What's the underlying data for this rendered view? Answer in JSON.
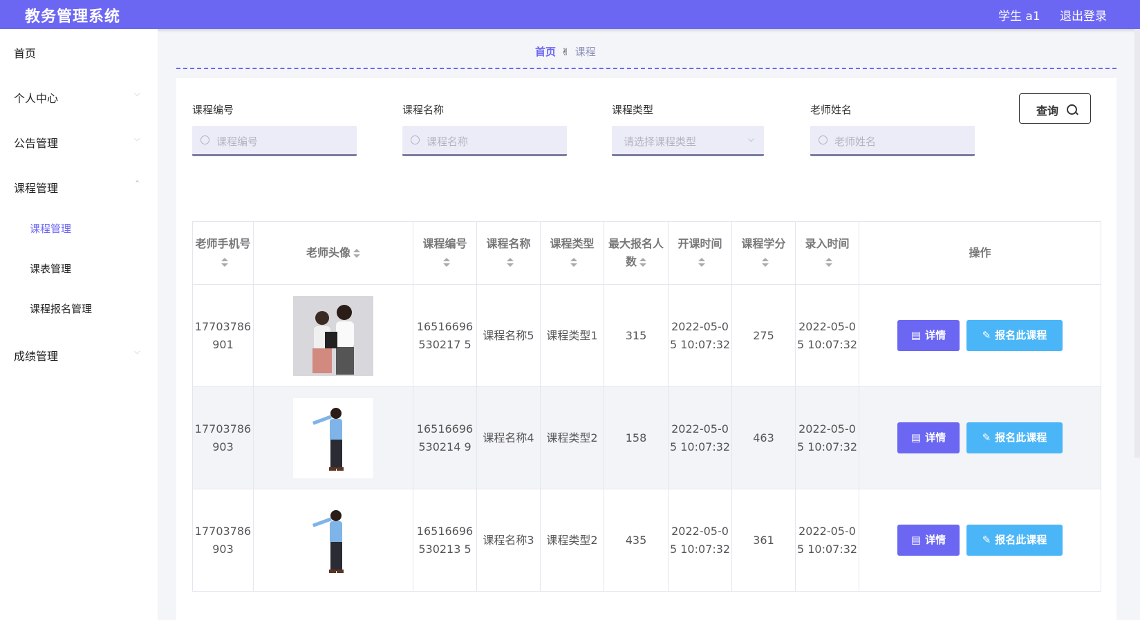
{
  "header": {
    "app_title": "教务管理系统",
    "user_label": "学生 a1",
    "logout_label": "退出登录"
  },
  "sidebar": {
    "items": [
      {
        "label": "首页"
      },
      {
        "label": "个人中心",
        "chevron": "⌵"
      },
      {
        "label": "公告管理",
        "chevron": "⌵"
      },
      {
        "label": "课程管理",
        "chevron": "⌃"
      },
      {
        "label": "成绩管理",
        "chevron": "⌵"
      }
    ],
    "sub_items": [
      {
        "label": "课程管理"
      },
      {
        "label": "课表管理"
      },
      {
        "label": "课程报名管理"
      }
    ]
  },
  "breadcrumb": {
    "home": "首页",
    "separator_icon": "✌",
    "current": "课程"
  },
  "search": {
    "fields": [
      {
        "label": "课程编号",
        "placeholder": "课程编号"
      },
      {
        "label": "课程名称",
        "placeholder": "课程名称"
      },
      {
        "label": "课程类型",
        "placeholder": "请选择课程类型"
      },
      {
        "label": "老师姓名",
        "placeholder": "老师姓名"
      }
    ],
    "query_label": "查询"
  },
  "table": {
    "headers": [
      "老师手机号",
      "老师头像",
      "课程编号",
      "课程名称",
      "课程类型",
      "最大报名人数",
      "开课时间",
      "课程学分",
      "录入时间",
      "操作"
    ],
    "rows": [
      {
        "phone": "17703786901",
        "avatar": "teacher-with-student-photo",
        "course_no": "16516696530217 5",
        "course_name": "课程名称5",
        "course_type": "课程类型1",
        "max_enroll": "315",
        "start_time": "2022-05-05 10:07:32",
        "credit": "275",
        "entry_time": "2022-05-05 10:07:32"
      },
      {
        "phone": "17703786903",
        "avatar": "teacher-pointing-photo",
        "course_no": "16516696530214 9",
        "course_name": "课程名称4",
        "course_type": "课程类型2",
        "max_enroll": "158",
        "start_time": "2022-05-05 10:07:32",
        "credit": "463",
        "entry_time": "2022-05-05 10:07:32"
      },
      {
        "phone": "17703786903",
        "avatar": "teacher-pointing-photo",
        "course_no": "16516696530213 5",
        "course_name": "课程名称3",
        "course_type": "课程类型2",
        "max_enroll": "435",
        "start_time": "2022-05-05 10:07:32",
        "credit": "361",
        "entry_time": "2022-05-05 10:07:32"
      }
    ],
    "detail_label": "详情",
    "enroll_label": "报名此课程"
  }
}
